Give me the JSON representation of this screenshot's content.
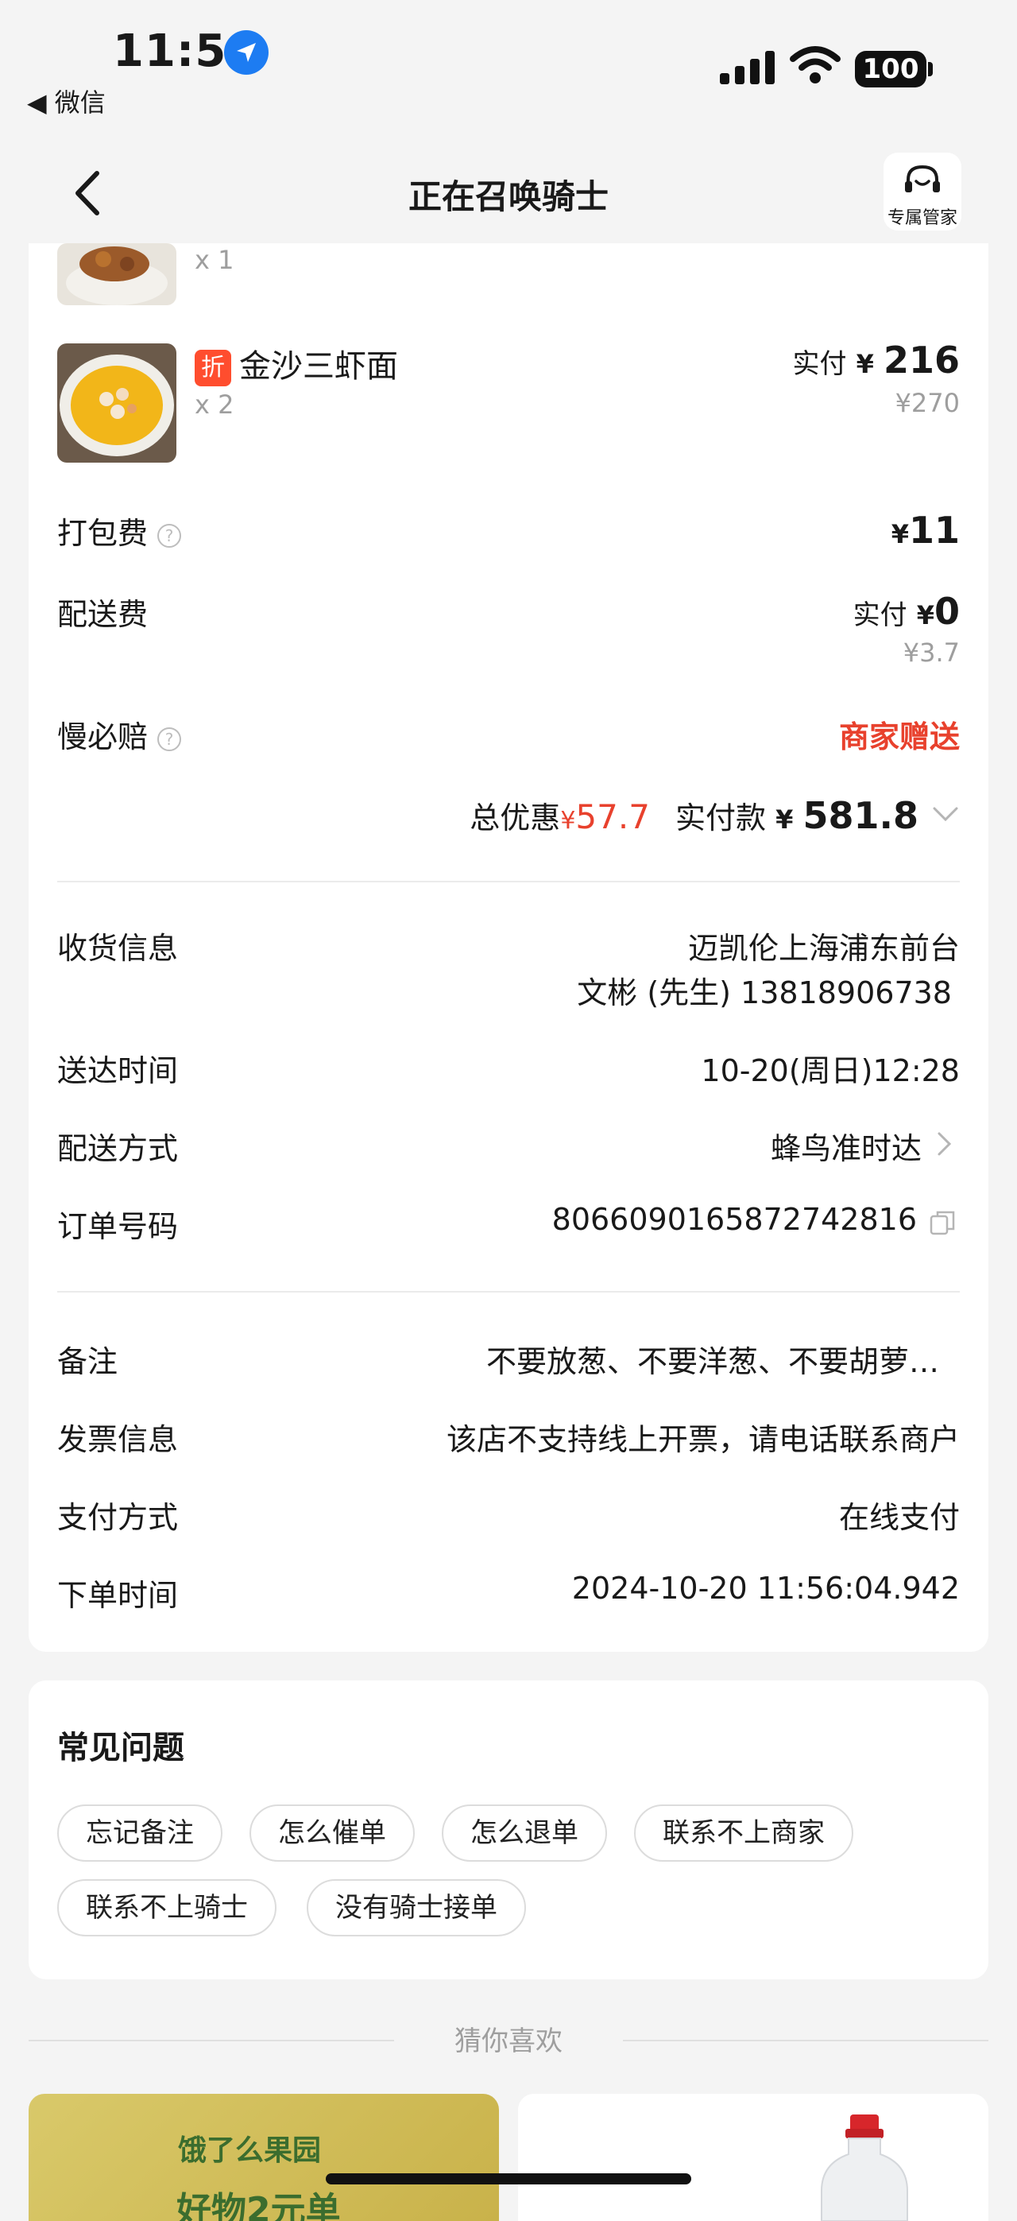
{
  "status_bar": {
    "time": "11:56",
    "back_app": "◀ 微信",
    "battery": "100"
  },
  "nav": {
    "title": "正在召唤骑士",
    "butler_label": "专属管家"
  },
  "items": [
    {
      "qty": "x 1"
    },
    {
      "name": "金沙三虾面",
      "tag": "折",
      "qty": "x 2",
      "paid_label": "实付",
      "yen": "¥",
      "paid": "216",
      "original": "¥270"
    }
  ],
  "fees": {
    "packing_label": "打包费",
    "packing_value": "11",
    "yen": "¥",
    "delivery_label": "配送费",
    "delivery_paid_label": "实付",
    "delivery_value": "0",
    "delivery_original": "¥3.7",
    "slow_label": "慢必赔",
    "slow_value": "商家赠送"
  },
  "totals": {
    "discount_label": "总优惠",
    "discount_yen": "¥",
    "discount": "57.7",
    "paid_label": "实付款",
    "paid_yen": "¥",
    "paid": "581.8"
  },
  "delivery_info": {
    "receiver_label": "收货信息",
    "receiver_line1": "迈凯伦上海浦东前台",
    "receiver_line2": "文彬 (先生) 13818906738",
    "time_label": "送达时间",
    "time_value": "10-20(周日)12:28",
    "method_label": "配送方式",
    "method_value": "蜂鸟准时达",
    "order_label": "订单号码",
    "order_value": "8066090165872742816"
  },
  "extra_info": {
    "note_label": "备注",
    "note_value": "不要放葱、不要洋葱、不要胡萝…",
    "invoice_label": "发票信息",
    "invoice_value": "该店不支持线上开票，请电话联系商户",
    "pay_label": "支付方式",
    "pay_value": "在线支付",
    "order_time_label": "下单时间",
    "order_time_value": "2024-10-20 11:56:04.942"
  },
  "faq": {
    "title": "常见问题",
    "chips": [
      "忘记备注",
      "怎么催单",
      "怎么退单",
      "联系不上商家",
      "联系不上骑士",
      "没有骑士接单"
    ]
  },
  "recommend": {
    "title": "猜你喜欢",
    "promo_brand": "饿了么果园",
    "promo_sub": "好物2元单"
  },
  "colors": {
    "accent_red": "#e8412d",
    "location_blue": "#1d7cf2"
  }
}
